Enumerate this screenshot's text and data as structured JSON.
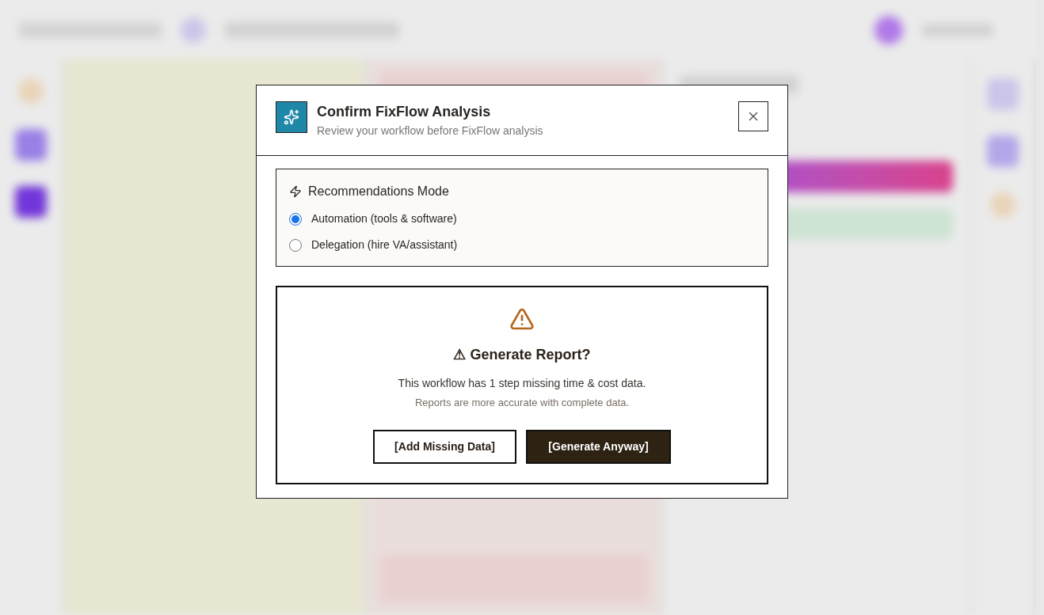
{
  "dialog": {
    "title": "Confirm FixFlow Analysis",
    "subtitle": "Review your workflow before FixFlow analysis",
    "mode": {
      "heading": "Recommendations Mode",
      "options": [
        {
          "label": "Automation (tools & software)",
          "selected": true
        },
        {
          "label": "Delegation (hire VA/assistant)",
          "selected": false
        }
      ]
    },
    "warning": {
      "title": "⚠ Generate Report?",
      "message": "This workflow has 1 step missing time & cost data.",
      "note": "Reports are more accurate with complete data.",
      "buttons": [
        {
          "label": "[Add Missing Data]",
          "kind": "secondary"
        },
        {
          "label": "[Generate Anyway]",
          "kind": "primary"
        }
      ]
    }
  }
}
